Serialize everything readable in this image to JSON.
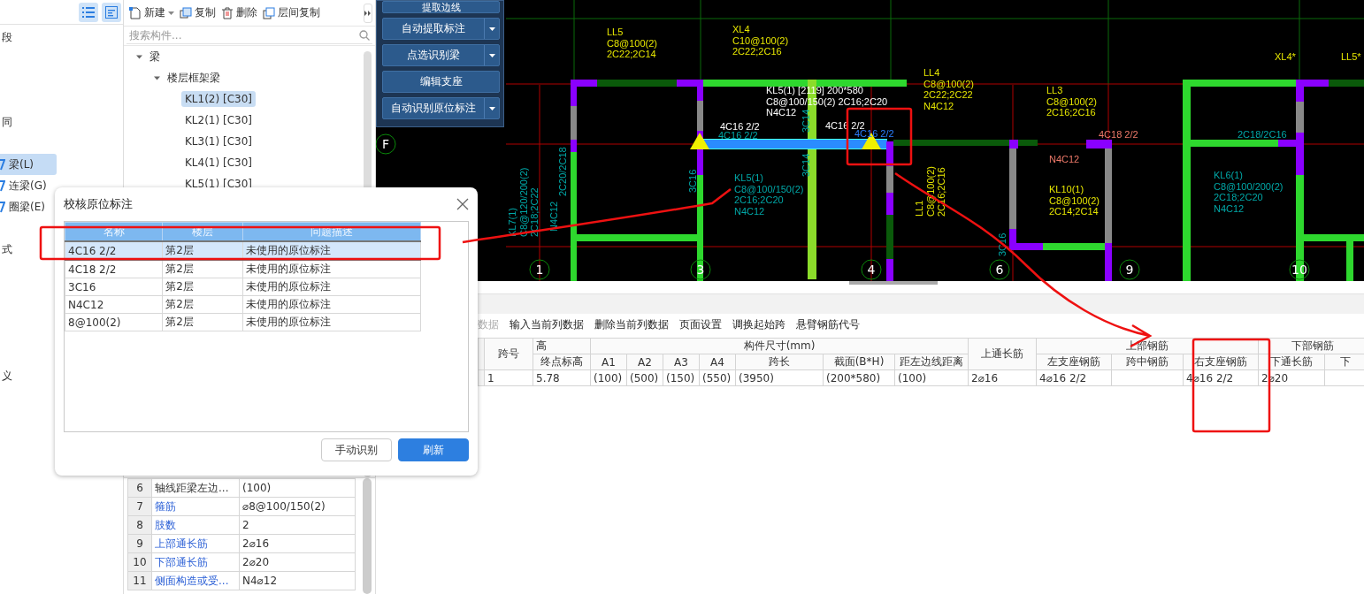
{
  "sidebar": {
    "items": [
      {
        "label": "段",
        "kind": "text",
        "selected": false
      },
      {
        "label": "同",
        "kind": "text",
        "selected": false
      },
      {
        "label": "梁(L)",
        "kind": "category",
        "selected": true
      },
      {
        "label": "连梁(G)",
        "kind": "category",
        "selected": false
      },
      {
        "label": "圈梁(E)",
        "kind": "category",
        "selected": false
      },
      {
        "label": "式",
        "kind": "text",
        "selected": false
      },
      {
        "label": "义",
        "kind": "text",
        "selected": false
      }
    ]
  },
  "component_panel": {
    "toolbar": [
      {
        "label": "新建",
        "kind": "new",
        "dropdown": true
      },
      {
        "label": "复制",
        "kind": "copy",
        "dropdown": false
      },
      {
        "label": "删除",
        "kind": "delete",
        "dropdown": false
      },
      {
        "label": "层间复制",
        "kind": "floor-copy",
        "dropdown": false
      }
    ],
    "search": {
      "placeholder": "搜索构件..."
    },
    "tree": [
      {
        "label": "梁",
        "expanded": true,
        "selected": false,
        "children": [
          {
            "label": "楼层框架梁",
            "expanded": true,
            "selected": false,
            "children": [
              {
                "label": "KL1(2) [C30]",
                "selected": true
              },
              {
                "label": "KL2(1) [C30]",
                "selected": false
              },
              {
                "label": "KL3(1) [C30]",
                "selected": false
              },
              {
                "label": "KL4(1) [C30]",
                "selected": false
              },
              {
                "label": "KL5(1) [C30]",
                "selected": false
              }
            ]
          }
        ]
      }
    ]
  },
  "properties": {
    "rows": [
      {
        "index": "6",
        "name": "轴线距梁左边...",
        "value": "(100)",
        "public": false
      },
      {
        "index": "7",
        "name": "箍筋",
        "value": "⌀8@100/150(2)",
        "public": true
      },
      {
        "index": "8",
        "name": "肢数",
        "value": "2",
        "public": true
      },
      {
        "index": "9",
        "name": "上部通长筋",
        "value": "2⌀16",
        "public": true
      },
      {
        "index": "10",
        "name": "下部通长筋",
        "value": "2⌀20",
        "public": true
      },
      {
        "index": "11",
        "name": "侧面构造或受...",
        "value": "N4⌀12",
        "public": true
      }
    ]
  },
  "recognition_panel": {
    "buttons": [
      {
        "label": "提取边线",
        "dropdown": false
      },
      {
        "label": "自动提取标注",
        "dropdown": true
      },
      {
        "label": "点选识别梁",
        "dropdown": true
      },
      {
        "label": "编辑支座",
        "dropdown": false
      },
      {
        "label": "自动识别原位标注",
        "dropdown": true
      }
    ]
  },
  "drawing": {
    "axis_labels": [
      "F",
      "1",
      "3",
      "4",
      "6",
      "9",
      "10"
    ],
    "labels": [
      {
        "lines": [
          "LL5",
          "C8@100(2)",
          "2C22;2C14"
        ],
        "color": "#e6e600"
      },
      {
        "lines": [
          "XL4",
          "C10@100(2)",
          "2C22;2C16"
        ],
        "color": "#e6e600"
      },
      {
        "lines": [
          "LL4",
          "C8@100(2)",
          "2C22;2C22",
          "N4C12"
        ],
        "color": "#e6e600"
      },
      {
        "lines": [
          "LL3",
          "C8@100(2)",
          "2C16;2C16"
        ],
        "color": "#e6e600"
      },
      {
        "lines": [
          "XL4*"
        ],
        "color": "#e6e600"
      },
      {
        "lines": [
          "LL5*"
        ],
        "color": "#e6e600"
      },
      {
        "lines": [
          "KL5(1) [2119] 200*580",
          "C8@100/150(2) 2C16;2C20",
          "N4C12"
        ],
        "color": "#ffffff"
      },
      {
        "lines": [
          "4C16 2/2"
        ],
        "color": "#ffffff"
      },
      {
        "lines": [
          "4C16 2/2"
        ],
        "color": "#00a8a8"
      },
      {
        "lines": [
          "4C16 2/2"
        ],
        "color": "#ffffff"
      },
      {
        "lines": [
          "4C16 2/2"
        ],
        "color": "#2a7fff"
      },
      {
        "lines": [
          "KL5(1)",
          "C8@100/150(2)",
          "2C16;2C20",
          "N4C12"
        ],
        "color": "#00a8a8"
      },
      {
        "lines": [
          "4C18 2/2"
        ],
        "color": "#f07a6a"
      },
      {
        "lines": [
          "N4C12"
        ],
        "color": "#f07a6a"
      },
      {
        "lines": [
          "KL10(1)",
          "C8@100(2)",
          "2C14;2C14"
        ],
        "color": "#e6e600"
      },
      {
        "lines": [
          "2C18/2C16"
        ],
        "color": "#00a8a8"
      },
      {
        "lines": [
          "KL6(1)",
          "C8@100/200(2)",
          "2C18;2C20",
          "N4C12"
        ],
        "color": "#00a8a8"
      },
      {
        "lines": [
          "KL7(1)",
          "C8@120/200(2)",
          "2C18;2C22"
        ],
        "color": "#00a8a8"
      },
      {
        "lines": [
          "N4C12"
        ],
        "color": "#00a8a8"
      },
      {
        "lines": [
          "2C20/2C18"
        ],
        "color": "#00a8a8"
      },
      {
        "lines": [
          "3C16"
        ],
        "color": "#00a8a8"
      },
      {
        "lines": [
          "3C14"
        ],
        "color": "#00a8a8"
      },
      {
        "lines": [
          "3C14"
        ],
        "color": "#00a8a8"
      },
      {
        "lines": [
          "LL1",
          "C8@100(2)",
          "2C16;2C16"
        ],
        "color": "#e6e600"
      },
      {
        "lines": [
          "3C16"
        ],
        "color": "#00a8a8"
      }
    ]
  },
  "span_table": {
    "toolbar": [
      {
        "label": "数据",
        "disabled": true
      },
      {
        "label": "输入当前列数据",
        "disabled": false
      },
      {
        "label": "删除当前列数据",
        "disabled": false
      },
      {
        "label": "页面设置",
        "disabled": false
      },
      {
        "label": "调换起始跨",
        "disabled": false
      },
      {
        "label": "悬臂钢筋代号",
        "disabled": false
      }
    ],
    "column_groups": [
      {
        "label": "跨号"
      },
      {
        "label": "高",
        "columns": [
          "终点标高"
        ]
      },
      {
        "label": "构件尺寸(mm)",
        "columns": [
          "A1",
          "A2",
          "A3",
          "A4",
          "跨长",
          "截面(B*H)",
          "距左边线距离"
        ]
      },
      {
        "label": "上通长筋"
      },
      {
        "label": "上部钢筋",
        "columns": [
          "左支座钢筋",
          "跨中钢筋",
          "右支座钢筋"
        ]
      },
      {
        "label": "下部钢筋",
        "columns": [
          "下通长筋",
          "下"
        ]
      }
    ],
    "rows": [
      {
        "cells": [
          "1",
          "5.78",
          "(100)",
          "(500)",
          "(150)",
          "(550)",
          "(3950)",
          "(200*580)",
          "(100)",
          "2⌀16",
          "4⌀16 2/2",
          null,
          "4⌀16 2/2",
          "2⌀20",
          null
        ]
      }
    ]
  },
  "dialog": {
    "title": "校核原位标注",
    "columns": [
      "名称",
      "楼层",
      "问题描述"
    ],
    "rows": [
      {
        "cells": [
          "4C16 2/2",
          "第2层",
          "未使用的原位标注"
        ],
        "selected": true
      },
      {
        "cells": [
          "4C18 2/2",
          "第2层",
          "未使用的原位标注"
        ],
        "selected": false
      },
      {
        "cells": [
          "3C16",
          "第2层",
          "未使用的原位标注"
        ],
        "selected": false
      },
      {
        "cells": [
          "N4C12",
          "第2层",
          "未使用的原位标注"
        ],
        "selected": false
      },
      {
        "cells": [
          "8@100(2)",
          "第2层",
          "未使用的原位标注"
        ],
        "selected": false
      }
    ],
    "buttons": [
      {
        "label": "手动识别",
        "primary": false
      },
      {
        "label": "刷新",
        "primary": true
      }
    ]
  }
}
